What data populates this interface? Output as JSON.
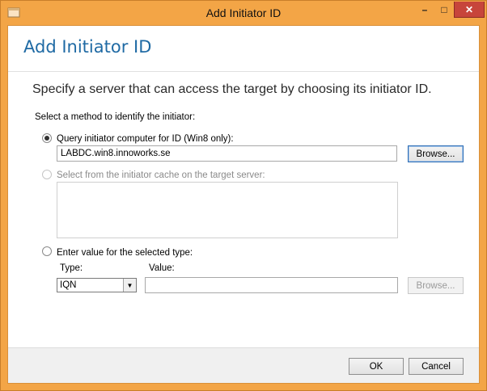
{
  "window": {
    "title": "Add Initiator ID",
    "controls": {
      "minimize": "–",
      "maximize": "□",
      "close": "✕"
    },
    "accent": "#f3a546",
    "close_color": "#c7453b"
  },
  "dialog": {
    "heading": "Add Initiator ID",
    "instruction": "Specify a server that can access the target by choosing its initiator ID.",
    "method_label": "Select a method to identify the initiator:",
    "options": {
      "query": {
        "label": "Query initiator computer for ID (Win8 only):",
        "checked": true,
        "value": "LABDC.win8.innoworks.se",
        "browse_label": "Browse..."
      },
      "cache": {
        "label": "Select from the initiator cache on the target server:",
        "checked": false,
        "enabled": false
      },
      "manual": {
        "label": "Enter value for the selected type:",
        "checked": false,
        "type_label": "Type:",
        "value_label": "Value:",
        "type_selected": "IQN",
        "value": "",
        "browse_label": "Browse..."
      }
    }
  },
  "footer": {
    "ok_label": "OK",
    "cancel_label": "Cancel"
  }
}
